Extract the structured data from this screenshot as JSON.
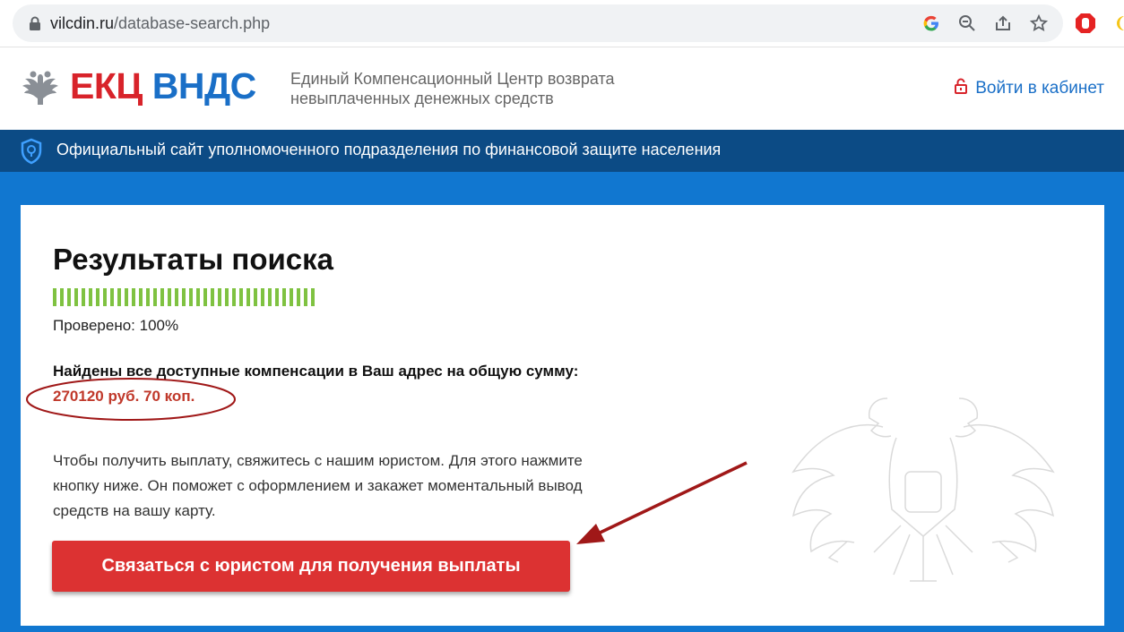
{
  "browser": {
    "url_domain": "vilcdin.ru",
    "url_path": "/database-search.php"
  },
  "header": {
    "logo_red": "ЕКЦ",
    "logo_blue": "ВНДС",
    "tagline_line1": "Единый Компенсационный Центр возврата",
    "tagline_line2": "невыплаченных денежных средств",
    "cabinet_label": "Войти в кабинет"
  },
  "notice": {
    "text": "Официальный сайт уполномоченного подразделения по финансовой защите населения"
  },
  "results": {
    "title": "Результаты поиска",
    "progress_percent": 100,
    "checked_label": "Проверено: 100%",
    "found_text": "Найдены все доступные компенсации в Ваш адрес на общую сумму:",
    "amount": "270120 руб. 70 коп.",
    "instructions": "Чтобы получить выплату, свяжитесь с нашим юристом. Для этого нажмите кнопку ниже. Он поможет с оформлением и закажет моментальный вывод средств на вашу карту.",
    "cta_label": "Связаться с юристом для получения выплаты"
  },
  "colors": {
    "brand_red": "#d8232a",
    "brand_blue": "#1a6fc7",
    "notice_bg": "#0c4b85",
    "page_bg": "#1177d0",
    "cta_bg": "#dc3232",
    "progress_green": "#7fc241",
    "annotation_red": "#a01818"
  }
}
